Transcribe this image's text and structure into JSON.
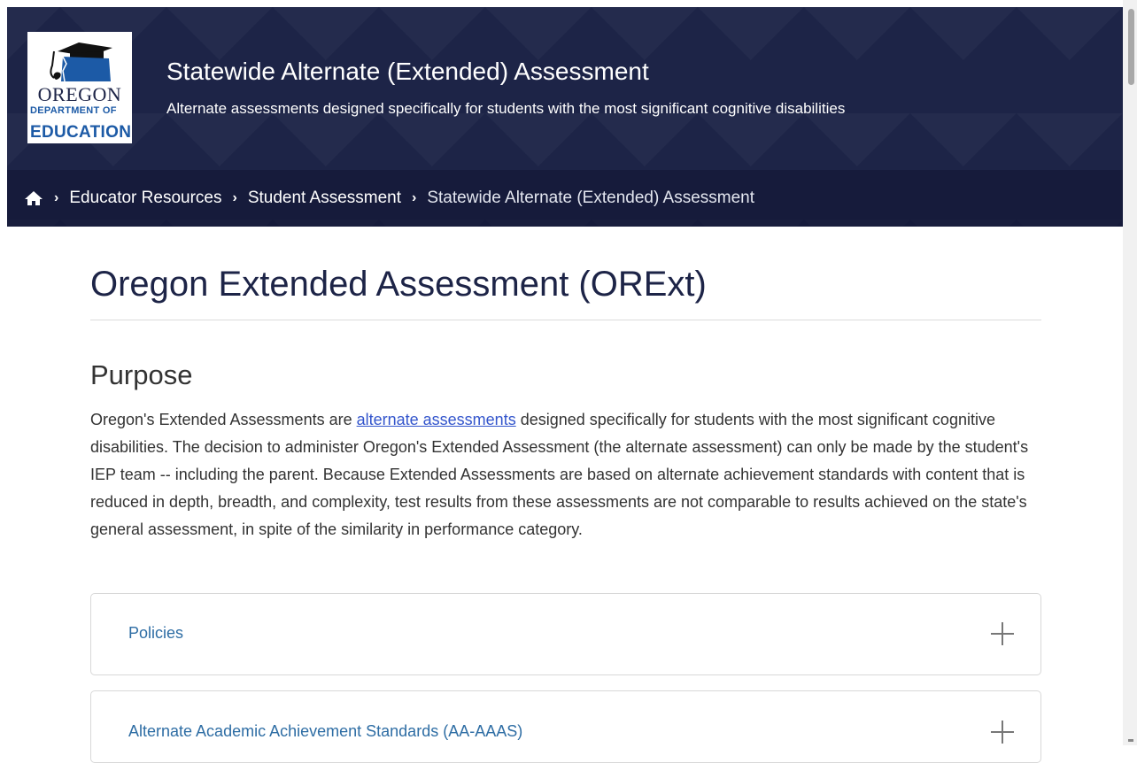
{
  "header": {
    "logo": {
      "line1": "OREGON",
      "line2": "DEPARTMENT OF",
      "line3": "EDUCATION",
      "icon": "graduation-cap-oregon-map-icon"
    },
    "title": "Statewide Alternate (Extended) Assessment",
    "subtitle": "Alternate assessments designed specifically for students with the most significant cognitive disabilities"
  },
  "breadcrumb": {
    "home_icon": "home-icon",
    "items": [
      "Educator Resources",
      "Student Assessment",
      "Statewide Alternate (Extended) Assessment"
    ]
  },
  "main": {
    "page_title": "Oregon Extended Assessment (ORExt)",
    "purpose": {
      "heading": "Purpose",
      "text_before_link": "Oregon's Extended Assessments are ",
      "link_text": "alternate assessments",
      "text_after_link": " designed specifically for students with the most significant cognitive disabilities. The decision to administer Oregon's Extended Assessment (the alternate assessment) can only be made by the student's IEP team -- including the parent. Because Extended Assessments are based on alternate achievement standards with content that is reduced in depth, breadth, and complexity, test results from these assessments are not comparable to results achieved on the state's general assessment, in spite of the similarity in performance category."
    },
    "accordions": [
      {
        "label": "Policies",
        "icon": "plus-icon"
      },
      {
        "label": "Alternate Academic Achievement Standards (AA-AAAS)",
        "icon": "plus-icon"
      }
    ]
  },
  "colors": {
    "header_bg": "#1d2447",
    "link": "#3355cc",
    "accordion_label": "#2e6da4"
  }
}
